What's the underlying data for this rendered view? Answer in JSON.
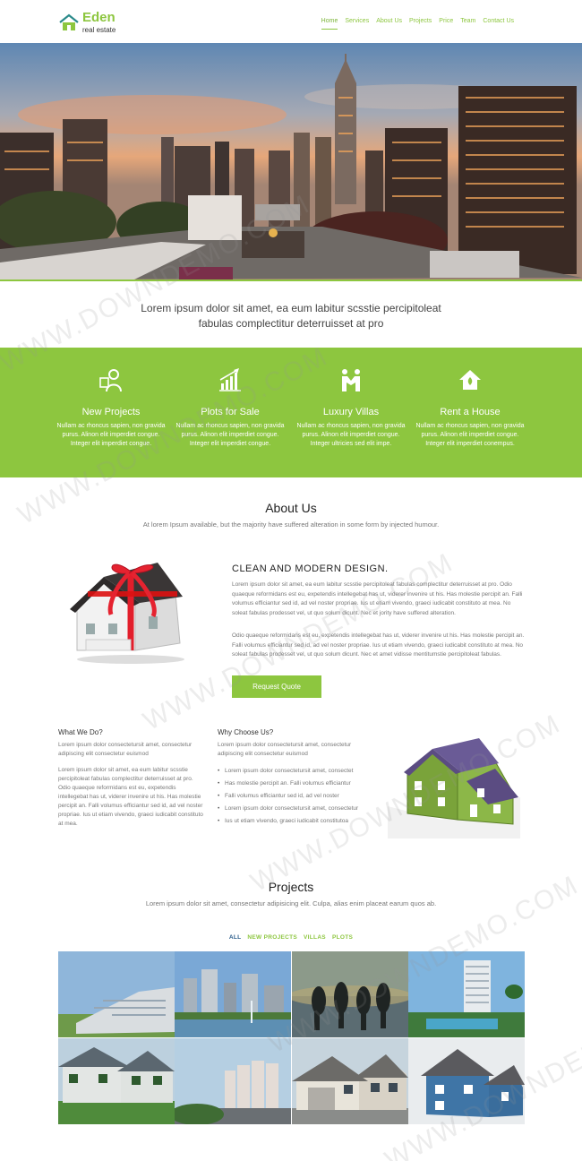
{
  "brand": {
    "title": "Eden",
    "subtitle": "real estate",
    "accent": "#8dc63f"
  },
  "nav": {
    "items": [
      {
        "label": "Home",
        "active": true
      },
      {
        "label": "Services"
      },
      {
        "label": "About Us"
      },
      {
        "label": "Projects"
      },
      {
        "label": "Price"
      },
      {
        "label": "Team"
      },
      {
        "label": "Contact Us"
      }
    ]
  },
  "hero": {
    "slides": 3,
    "active_slide": 2
  },
  "intro": {
    "line1": "Lorem ipsum dolor sit amet, ea eum labitur scsstie percipitoleat",
    "line2": "fabulas complectitur deterruisset at pro"
  },
  "services": [
    {
      "icon": "agent-icon",
      "title": "New Projects",
      "text": "Nullam ac rhoncus sapien, non gravida purus. Alinon elit imperdiet congue. Integer elit imperdiet congue."
    },
    {
      "icon": "growth-chart-icon",
      "title": "Plots for Sale",
      "text": "Nullam ac rhoncus sapien, non gravida purus. Alinon elit imperdiet congue. Integer elit imperdiet congue."
    },
    {
      "icon": "handshake-icon",
      "title": "Luxury Villas",
      "text": "Nullam ac rhoncus sapien, non gravida purus. Alinon elit imperdiet congue. Integer ultricies sed elit impe."
    },
    {
      "icon": "house-icon",
      "title": "Rent a House",
      "text": "Nullam ac rhoncus sapien, non gravida purus. Alinon elit imperdiet congue. Integer elit imperdiet conempus."
    }
  ],
  "about": {
    "title": "About Us",
    "subtitle": "At lorem Ipsum available, but the majority have suffered alteration in some form by injected humour.",
    "heading": "CLEAN AND MODERN DESIGN.",
    "p1": "Lorem ipsum dolor sit amet, ea eum labitur scsstie percipitoleat fabulas complectitur deterruisset at pro. Odio quaeque reformidans est eu, expetendis intellegebat has ut, viderer invenire ut his. Has molestie percipit an. Falli volumus efficiantur sed id, ad vel noster propriae. Ius ut etiam vivendo, graeci iudicabit constituto at mea. No soleat fabulas prodesset vel, ut quo solum dicunt. Nec et jority have suffered alteration.",
    "p2": "Odio quaeque reformidans est eu, expetendis intellegebat has ut, viderer invenire ut his. Has molestie percipit an. Falli volumus efficiantur sed id, ad vel noster propriae. Ius ut etiam vivendo, graeci iudicabit constituto at mea. No soleat fabulas prodesset vel, ut quo solum dicunt. Nec et amet vidisse mentitumstie percipitoleat fabulas.",
    "button": "Request Quote"
  },
  "what": {
    "title": "What We Do?",
    "p1": "Lorem ipsum dolor consectetursit amet, consectetur adipiscing elit consectetur euismod",
    "p2": "Lorem ipsum dolor sit amet, ea eum labitur scsstie percipitoleat fabulas complectitur deterruisset at pro. Odio quaeque reformidans est eu, expetendis intellegebat has ut, viderer invenire ut his. Has molestie percipit an. Falli volumus efficiantur sed id, ad vel noster propriae. Ius ut etiam vivendo, graeci iudicabit constituto at mea."
  },
  "why": {
    "title": "Why Choose Us?",
    "p1": "Lorem ipsum dolor consectetursit amet, consectetur adipiscing elit consectetur euismod",
    "items": [
      "Lorem ipsum dolor consectetursit amet, consectet",
      "Has molestie percipit an. Falli volumus efficiantur",
      "Falli volumus efficiantur sed id, ad vel noster",
      "Lorem ipsum dolor consectetursit amet, consectetur",
      "Ius ut etiam vivendo, graeci iudicabit constitutoa"
    ]
  },
  "projects": {
    "title": "Projects",
    "subtitle": "Lorem ipsum dolor sit amet, consectetur adipisicing elit. Culpa, alias enim placeat earum quos ab.",
    "filters": [
      {
        "label": "ALL",
        "active": true
      },
      {
        "label": "NEW PROJECTS"
      },
      {
        "label": "VILLAS"
      },
      {
        "label": "PLOTS"
      }
    ],
    "tiles": [
      "apartment-complex",
      "city-lake-fountain",
      "people-jumping-sunset",
      "tower-pool",
      "green-townhouses",
      "high-rise-row",
      "suburban-house",
      "blue-house-model"
    ]
  },
  "watermark": "WWW.DOWNDEMO.COM"
}
